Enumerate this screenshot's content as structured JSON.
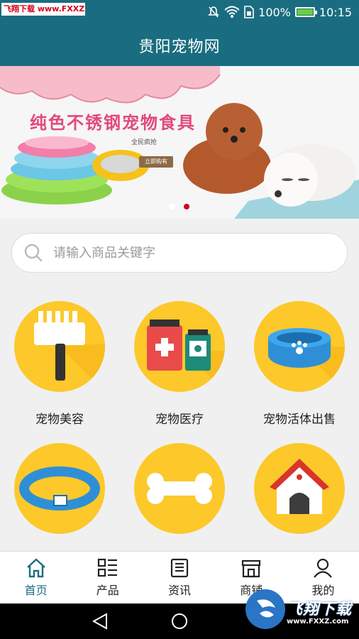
{
  "status_bar": {
    "watermark": "飞翔下载 www.FXXZ.com",
    "battery": "100%",
    "battery_level": 1.0,
    "time": "10:15"
  },
  "app_bar": {
    "title": "贵阳宠物网"
  },
  "banner": {
    "headline": "纯色不锈钢宠物食具",
    "subline": "全民疯抢",
    "button_label": "立即购有",
    "slide_count": 2,
    "active_slide": 2
  },
  "search": {
    "placeholder": "请输入商品关键字",
    "value": ""
  },
  "categories": [
    {
      "label": "宠物美容",
      "icon": "comb-icon"
    },
    {
      "label": "宠物医疗",
      "icon": "medical-kit-icon"
    },
    {
      "label": "宠物活体出售",
      "icon": "pet-bowl-icon"
    },
    {
      "label": "",
      "icon": "pet-collar-icon"
    },
    {
      "label": "",
      "icon": "bone-icon"
    },
    {
      "label": "",
      "icon": "dog-house-icon"
    }
  ],
  "bottom_nav": {
    "items": [
      {
        "label": "首页",
        "icon": "home-icon",
        "active": true
      },
      {
        "label": "产品",
        "icon": "product-list-icon",
        "active": false
      },
      {
        "label": "资讯",
        "icon": "news-icon",
        "active": false
      },
      {
        "label": "商铺",
        "icon": "shop-icon",
        "active": false
      },
      {
        "label": "我的",
        "icon": "user-icon",
        "active": false
      }
    ]
  },
  "brand_watermark": {
    "text": "飞翔下载",
    "url_text": "www.FXXZ.com"
  },
  "colors": {
    "primary": "#1a6d80",
    "accent": "#fdc82a",
    "active_dot": "#d0021b"
  }
}
